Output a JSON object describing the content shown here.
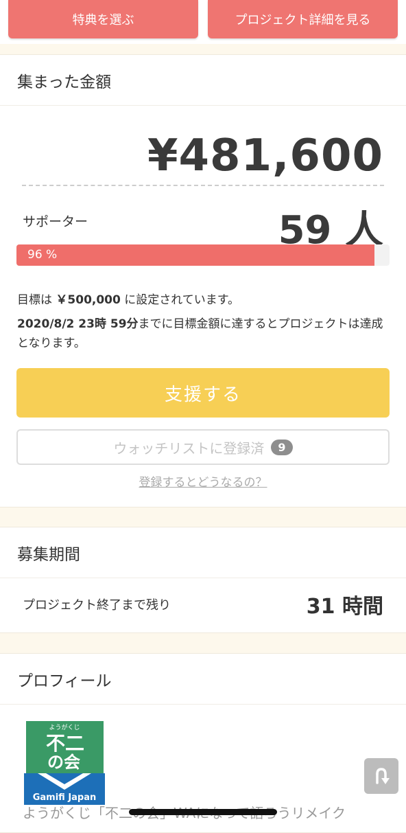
{
  "top": {
    "select_reward": "特典を選ぶ",
    "view_details": "プロジェクト詳細を見る"
  },
  "funding": {
    "header": "集まった金額",
    "amount": "¥481,600",
    "supporters_label": "サポーター",
    "supporters_value": "59 人",
    "progress_percent": 96,
    "progress_label": "96 %",
    "goal_prefix": "目標は ",
    "goal_amount": "￥500,000",
    "goal_suffix": " に設定されています。",
    "deadline_bold": "2020/8/2 23時 59分",
    "deadline_text": "までに目標金額に達するとプロジェクトは達成となります。",
    "support_button": "支援する",
    "watchlist_button": "ウォッチリストに登録済",
    "watchlist_count": "9",
    "what_happens_link": "登録するとどうなるの？"
  },
  "period": {
    "header": "募集期間",
    "remaining_label": "プロジェクト終了まで残り",
    "remaining_value": "31 時間"
  },
  "profile": {
    "header": "プロフィール",
    "logo_small": "ようがくじ",
    "logo_title_1": "不二",
    "logo_title_2": "の会",
    "logo_caption": "Gamifi Japan",
    "text": "ようがくじ「不二の会」WAになって語ろうリメイク"
  },
  "colors": {
    "accent": "#ef7571",
    "support": "#f7cf55",
    "progress": "#ef6e6a"
  },
  "icons": {
    "scroll_top": "scroll-top-arrow-icon"
  }
}
